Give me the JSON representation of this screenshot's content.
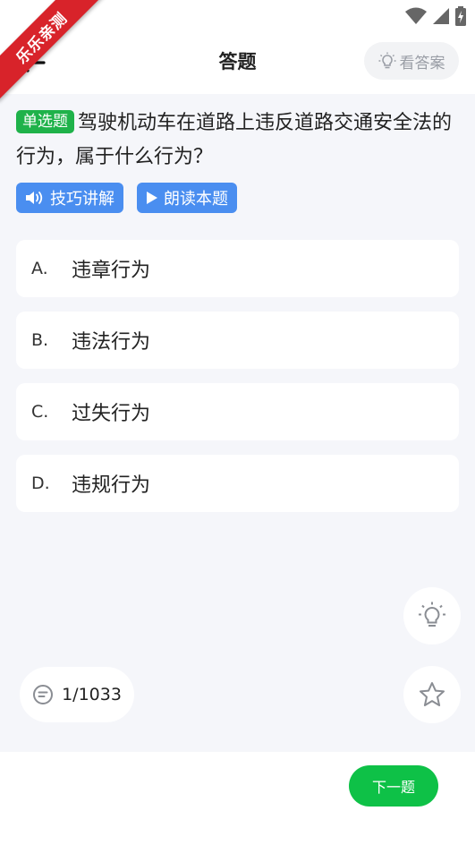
{
  "watermark": {
    "text": "乐乐亲测"
  },
  "header": {
    "title": "答题",
    "answer_button": "看答案",
    "back_icon": "arrow-left-icon"
  },
  "question": {
    "type_badge": "单选题",
    "text": "驾驶机动车在道路上违反道路交通安全法的行为，属于什么行为？"
  },
  "tools": [
    {
      "label": "技巧讲解",
      "icon": "speaker-icon"
    },
    {
      "label": "朗读本题",
      "icon": "play-icon"
    }
  ],
  "options": [
    {
      "letter": "A.",
      "text": "违章行为"
    },
    {
      "letter": "B.",
      "text": "违法行为"
    },
    {
      "letter": "C.",
      "text": "过失行为"
    },
    {
      "letter": "D.",
      "text": "违规行为"
    }
  ],
  "progress": {
    "counter": "1/1033"
  },
  "footer": {
    "next_button": "下一题"
  },
  "colors": {
    "accent_green": "#0ec147",
    "badge_green": "#1fb24a",
    "tool_blue": "#4a8ef0",
    "ribbon_red": "#d8232a",
    "background": "#f5f6fa"
  }
}
